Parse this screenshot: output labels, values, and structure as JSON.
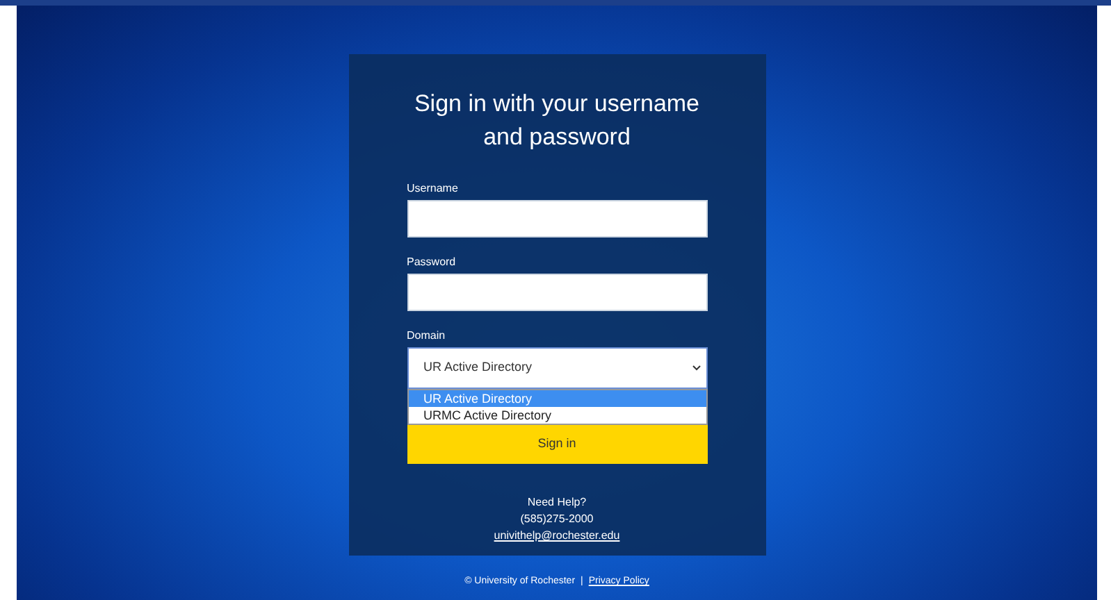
{
  "title": "Sign in with your username and password",
  "fields": [
    {
      "label": "Username"
    },
    {
      "label": "Password"
    }
  ],
  "domain": {
    "label": "Domain",
    "value": "UR Active Directory",
    "expanded": true,
    "options": [
      {
        "label": "UR Active Directory",
        "selected": true
      },
      {
        "label": "URMC Active Directory",
        "selected": false
      }
    ]
  },
  "sign_in_button": "Sign in",
  "help": {
    "heading": "Need Help?",
    "phone": "(585)275-2000",
    "email": "univithelp@rochester.edu"
  },
  "footer": {
    "copyright": "© University of Rochester",
    "separator": "|",
    "privacy_link": "Privacy Policy"
  }
}
